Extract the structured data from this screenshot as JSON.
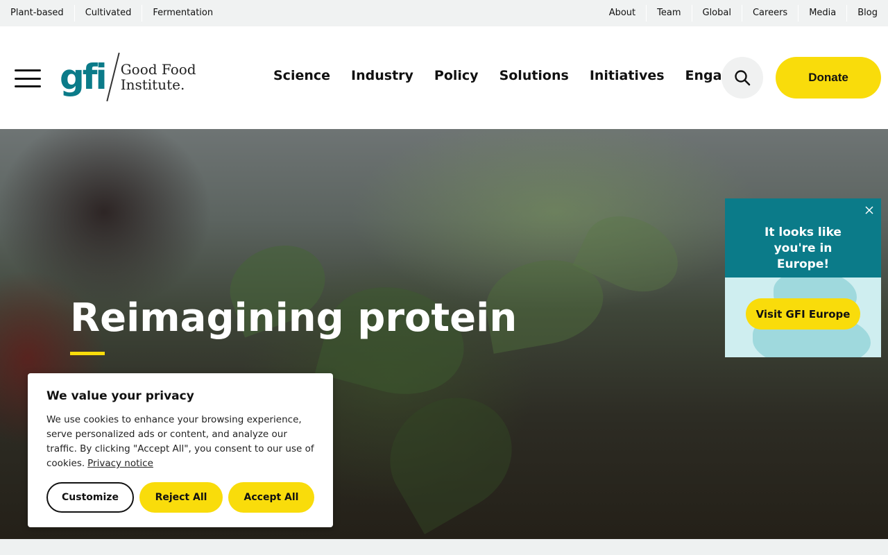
{
  "utility_nav": {
    "left": [
      "Plant-based",
      "Cultivated",
      "Fermentation"
    ],
    "right": [
      "About",
      "Team",
      "Global",
      "Careers",
      "Media",
      "Blog"
    ]
  },
  "header": {
    "logo_mark": "gfi",
    "logo_line1": "Good Food",
    "logo_line2": "Institute.",
    "nav": [
      "Science",
      "Industry",
      "Policy",
      "Solutions",
      "Initiatives",
      "Engage"
    ],
    "donate_label": "Donate",
    "icons": {
      "menu": "hamburger-menu-icon",
      "search": "search-icon"
    }
  },
  "hero": {
    "title": "Reimagining protein"
  },
  "europe_popup": {
    "title": "It looks like you're in Europe!",
    "button_label": "Visit GFI Europe",
    "close_icon": "close-icon"
  },
  "cookie_banner": {
    "title": "We value your privacy",
    "body": "We use cookies to enhance your browsing experience, serve personalized ads or content, and analyze our traffic. By clicking \"Accept All\", you consent to our use of cookies.",
    "link_label": "Privacy notice",
    "customize_label": "Customize",
    "reject_label": "Reject All",
    "accept_label": "Accept All"
  },
  "colors": {
    "brand_teal": "#0b7b89",
    "accent_yellow": "#f9dc0b"
  }
}
